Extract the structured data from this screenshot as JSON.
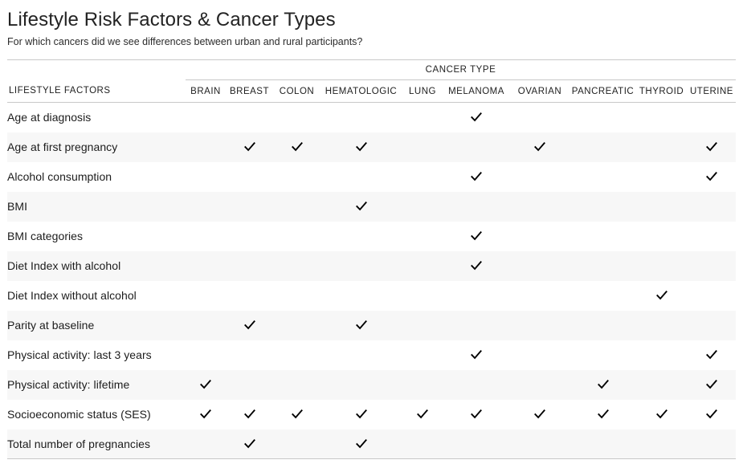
{
  "header": {
    "title": "Lifestyle Risk Factors & Cancer Types",
    "subtitle": "For which cancers did we see differences between urban and rural participants?"
  },
  "table": {
    "group_header": "CANCER TYPE",
    "row_header_label": "LIFESTYLE FACTORS",
    "columns": [
      "BRAIN",
      "BREAST",
      "COLON",
      "HEMATOLOGIC",
      "LUNG",
      "MELANOMA",
      "OVARIAN",
      "PANCREATIC",
      "THYROID",
      "UTERINE"
    ],
    "check_icon": "check-icon",
    "check_glyph": "✓",
    "rows": [
      {
        "label": "Age at diagnosis",
        "checks": [
          false,
          false,
          false,
          false,
          false,
          true,
          false,
          false,
          false,
          false
        ]
      },
      {
        "label": "Age at first pregnancy",
        "checks": [
          false,
          true,
          true,
          true,
          false,
          false,
          true,
          false,
          false,
          true
        ]
      },
      {
        "label": "Alcohol consumption",
        "checks": [
          false,
          false,
          false,
          false,
          false,
          true,
          false,
          false,
          false,
          true
        ]
      },
      {
        "label": "BMI",
        "checks": [
          false,
          false,
          false,
          true,
          false,
          false,
          false,
          false,
          false,
          false
        ]
      },
      {
        "label": "BMI categories",
        "checks": [
          false,
          false,
          false,
          false,
          false,
          true,
          false,
          false,
          false,
          false
        ]
      },
      {
        "label": "Diet Index with alcohol",
        "checks": [
          false,
          false,
          false,
          false,
          false,
          true,
          false,
          false,
          false,
          false
        ]
      },
      {
        "label": "Diet Index without alcohol",
        "checks": [
          false,
          false,
          false,
          false,
          false,
          false,
          false,
          false,
          true,
          false
        ]
      },
      {
        "label": "Parity at baseline",
        "checks": [
          false,
          true,
          false,
          true,
          false,
          false,
          false,
          false,
          false,
          false
        ]
      },
      {
        "label": "Physical activity: last 3 years",
        "checks": [
          false,
          false,
          false,
          false,
          false,
          true,
          false,
          false,
          false,
          true
        ]
      },
      {
        "label": "Physical activity: lifetime",
        "checks": [
          true,
          false,
          false,
          false,
          false,
          false,
          false,
          true,
          false,
          true
        ]
      },
      {
        "label": "Socioeconomic status (SES)",
        "checks": [
          true,
          true,
          true,
          true,
          true,
          true,
          true,
          true,
          true,
          true
        ]
      },
      {
        "label": "Total number of pregnancies",
        "checks": [
          false,
          true,
          false,
          true,
          false,
          false,
          false,
          false,
          false,
          false
        ]
      }
    ]
  },
  "colors": {
    "rule": "#c8c8c8",
    "alt_row": "#f7f7f7",
    "text": "#1c1c1c",
    "check": "#000000"
  }
}
